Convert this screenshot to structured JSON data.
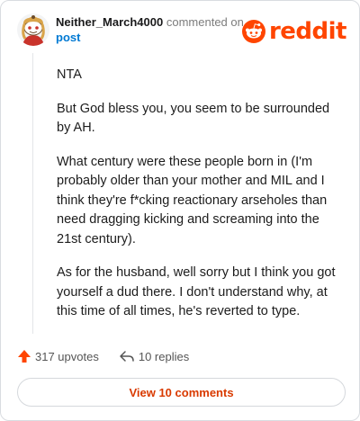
{
  "comment": {
    "username": "Neither_March4000",
    "action_text": "commented on",
    "post_link": "post",
    "paragraphs": [
      "NTA",
      "But God bless you, you seem to be surrounded by AH.",
      "What century were these people born in (I'm probably older than your mother and MIL and I think they're f*cking reactionary arseholes than need dragging kicking and screaming into the 21st century).",
      "As for the husband, well sorry but I think you got yourself a dud there. I don't understand why, at this time of all times, he's reverted to type."
    ],
    "upvotes": "317 upvotes",
    "replies": "10 replies",
    "view_comments": "View 10 comments"
  },
  "brand": {
    "logo_text": "reddit",
    "color": "#ff4500"
  },
  "icons": {
    "avatar": "avatar-snoo",
    "logo": "reddit-snoo-icon",
    "upvote": "upvote-arrow-icon",
    "reply": "reply-arrow-icon"
  },
  "colors": {
    "upvote": "#ff4500",
    "link": "#0079d3",
    "button_text": "#d93a00"
  }
}
